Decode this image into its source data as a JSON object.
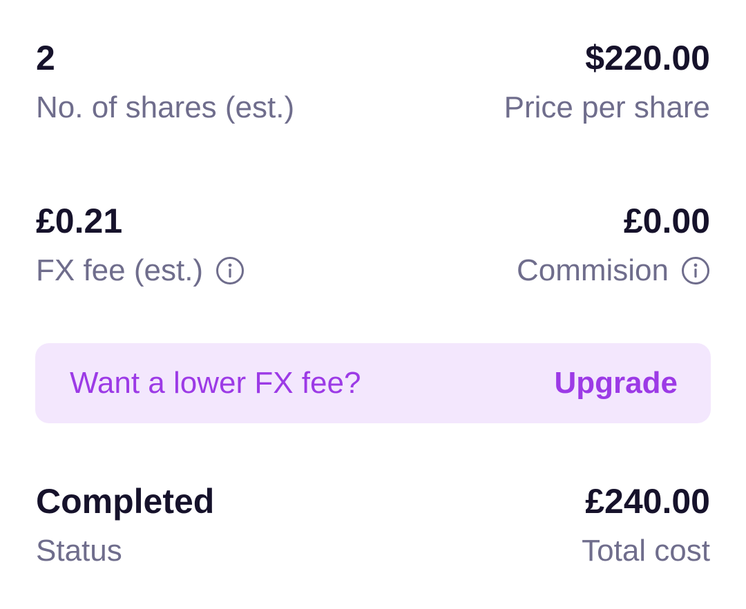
{
  "shares": {
    "value": "2",
    "label": "No. of shares (est.)"
  },
  "price": {
    "value": "$220.00",
    "label": "Price per share"
  },
  "fx_fee": {
    "value": "£0.21",
    "label": "FX fee (est.)",
    "icon": "info-icon"
  },
  "commission": {
    "value": "£0.00",
    "label": "Commision",
    "icon": "info-icon"
  },
  "upgrade_banner": {
    "text": "Want a lower FX fee?",
    "link_label": "Upgrade",
    "background_color": "#f3e7fd",
    "accent_color": "#9c3ae6"
  },
  "status": {
    "value": "Completed",
    "label": "Status"
  },
  "total": {
    "value": "£240.00",
    "label": "Total cost"
  }
}
